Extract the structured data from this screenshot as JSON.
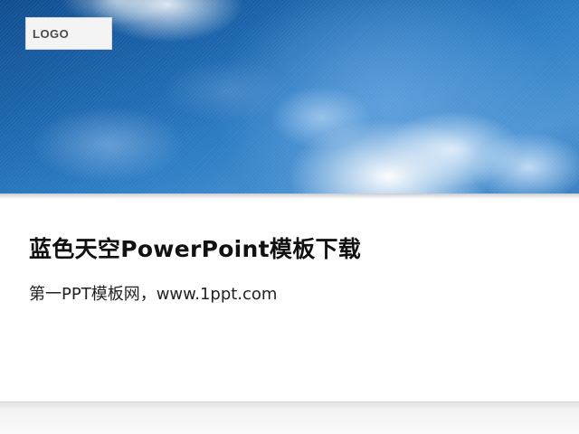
{
  "slide": {
    "logo_text": "LOGO",
    "title": "蓝色天空PowerPoint模板下载",
    "subtitle": "第一PPT模板网，www.1ppt.com"
  },
  "colors": {
    "sky_dark": "#0f4d8f",
    "sky_light": "#5e9fdb",
    "title_text": "#111111",
    "footer": "#e2e3e5"
  }
}
